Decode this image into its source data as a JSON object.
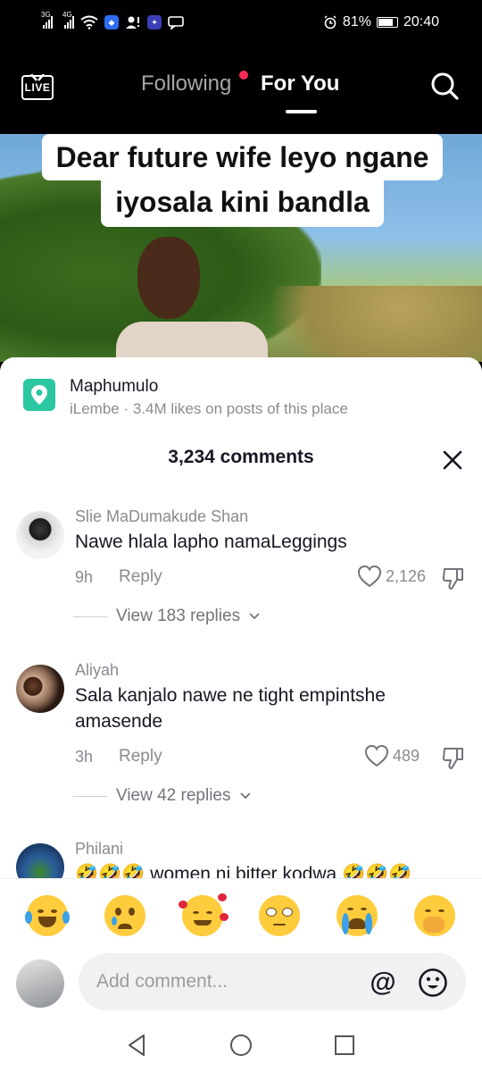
{
  "status_bar": {
    "signal1_label": "3G",
    "signal2_label": "4G",
    "battery_percent": "81%",
    "time": "20:40",
    "icons": [
      "signal-icon",
      "signal-icon",
      "wifi-icon",
      "security-icon",
      "user-alert-icon",
      "app-icon",
      "chat-icon",
      "alarm-icon",
      "battery-icon"
    ]
  },
  "top_nav": {
    "live_label": "LIVE",
    "tab_following": "Following",
    "tab_for_you": "For You",
    "active_tab": "For You",
    "accent_color": "#fe2c55"
  },
  "video": {
    "caption_line1": "Dear future wife leyo ngane",
    "caption_line2": "iyosala kini bandla"
  },
  "place": {
    "name": "Maphumulo",
    "subtitle": "iLembe · 3.4M likes on posts of this place",
    "icon": "location-pin-icon",
    "icon_color": "#2bc7a0"
  },
  "comments_panel": {
    "title": "3,234 comments",
    "comments": [
      {
        "user": "Slie MaDumakude Shan",
        "text": "Nawe hlala lapho namaLeggings",
        "time": "9h",
        "reply_label": "Reply",
        "likes": "2,126",
        "view_replies": "View 183 replies"
      },
      {
        "user": "Aliyah",
        "text": "Sala kanjalo nawe ne tight empintshe amasende",
        "time": "3h",
        "reply_label": "Reply",
        "likes": "489",
        "view_replies": "View 42 replies"
      },
      {
        "user": "Philani",
        "text": "🤣🤣🤣 women ni bitter kodwa 🤣🤣🤣"
      }
    ]
  },
  "emoji_bar": [
    "😂",
    "😢",
    "🥰",
    "🙄",
    "😭",
    "🤭"
  ],
  "comment_input": {
    "placeholder": "Add comment..."
  }
}
